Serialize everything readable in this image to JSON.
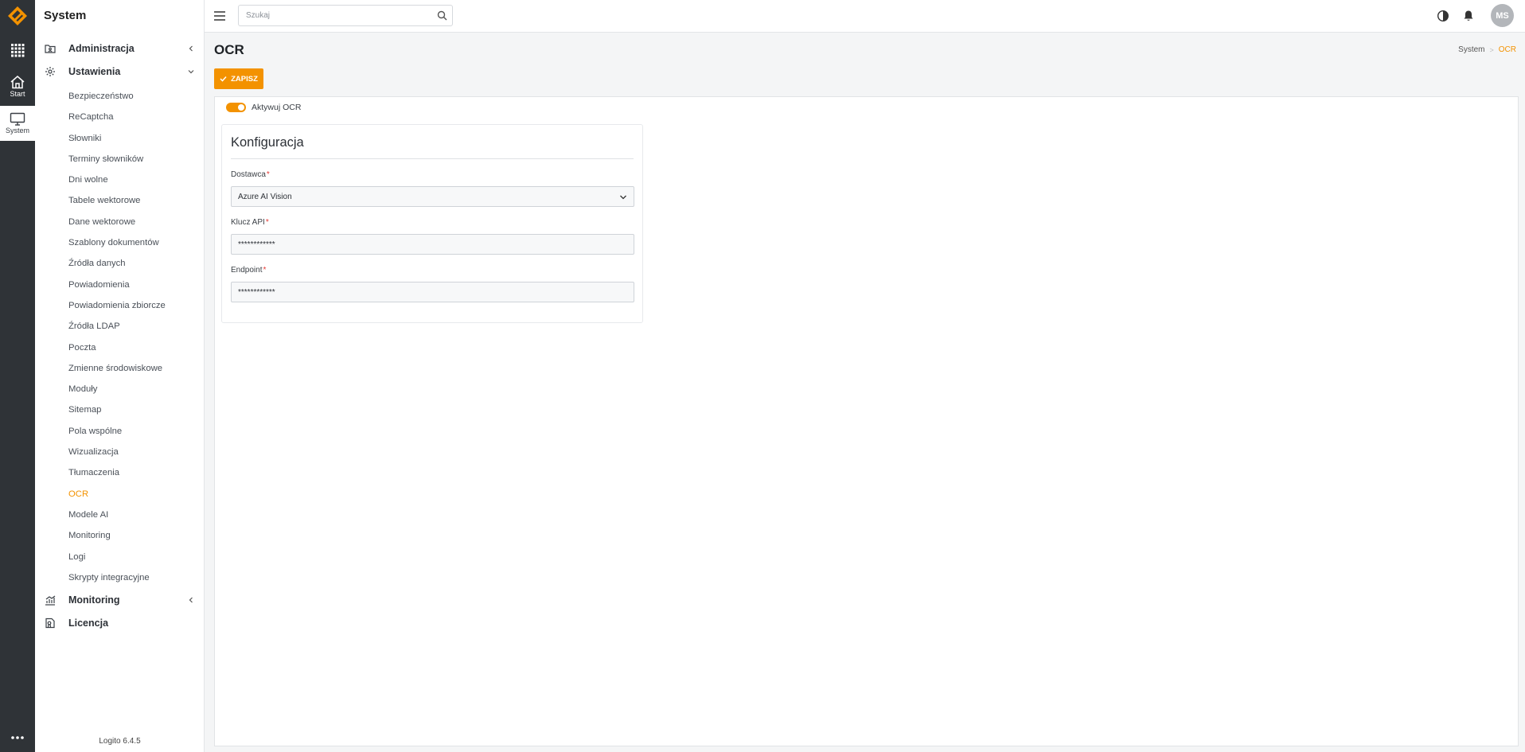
{
  "app": {
    "section_title": "System",
    "version": "Logito 6.4.5"
  },
  "rail": {
    "start_label": "Start",
    "system_label": "System"
  },
  "sidebar": {
    "groups": {
      "administracja": "Administracja",
      "ustawienia": "Ustawienia",
      "monitoring": "Monitoring",
      "licencja": "Licencja"
    },
    "items": [
      "Bezpieczeństwo",
      "ReCaptcha",
      "Słowniki",
      "Terminy słowników",
      "Dni wolne",
      "Tabele wektorowe",
      "Dane wektorowe",
      "Szablony dokumentów",
      "Źródła danych",
      "Powiadomienia",
      "Powiadomienia zbiorcze",
      "Źródła LDAP",
      "Poczta",
      "Zmienne środowiskowe",
      "Moduły",
      "Sitemap",
      "Pola wspólne",
      "Wizualizacja",
      "Tłumaczenia",
      "OCR",
      "Modele AI",
      "Monitoring",
      "Logi",
      "Skrypty integracyjne"
    ],
    "active_item": "OCR"
  },
  "topbar": {
    "search_placeholder": "Szukaj",
    "avatar_initials": "MS"
  },
  "page": {
    "title": "OCR",
    "breadcrumb": [
      "System",
      "OCR"
    ],
    "save_label": "ZAPISZ",
    "toggle_label": "Aktywuj OCR",
    "toggle_on": true
  },
  "config": {
    "title": "Konfiguracja",
    "provider_label": "Dostawca",
    "provider_value": "Azure AI Vision",
    "api_key_label": "Klucz API",
    "api_key_value": "************",
    "endpoint_label": "Endpoint",
    "endpoint_value": "************",
    "required_mark": "*"
  },
  "colors": {
    "accent": "#f39200",
    "rail": "#2f3337",
    "required": "#e53935"
  }
}
